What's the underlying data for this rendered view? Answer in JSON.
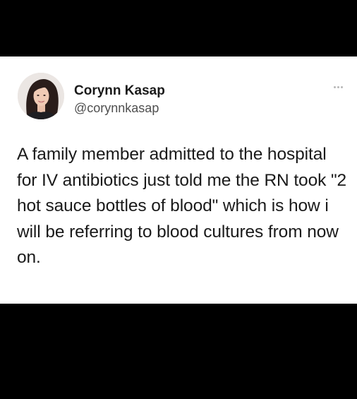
{
  "tweet": {
    "author": {
      "name": "Corynn Kasap",
      "handle": "@corynnkasap",
      "avatar_icon": "profile-photo"
    },
    "more_icon": "ellipsis-icon",
    "text": "A family member admitted to the hospital for IV antibiotics just told me the RN took \"2 hot sauce bottles of blood\" which is how i will be referring to blood cultures from now on."
  },
  "colors": {
    "background": "#000000",
    "card": "#ffffff",
    "text": "#1a1a1a",
    "handle": "#4f4f4f",
    "hair": "#2a1d1a"
  }
}
